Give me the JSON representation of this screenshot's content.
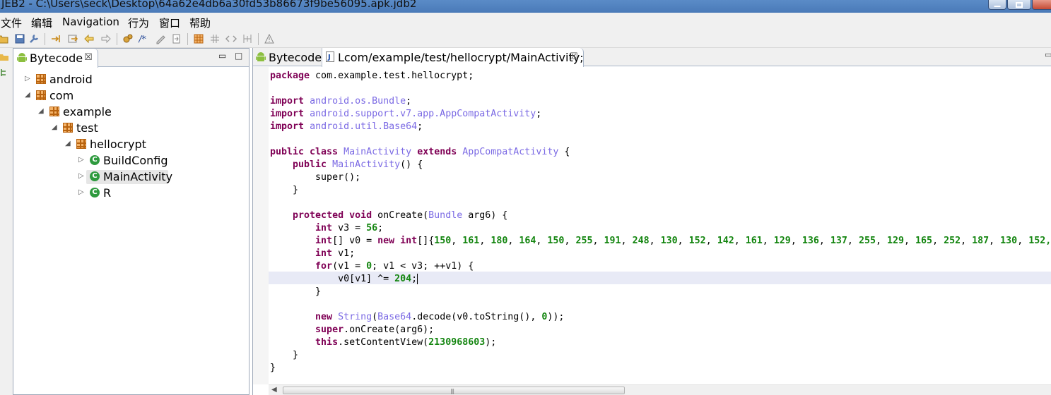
{
  "window": {
    "title": "JEB2 - C:\\Users\\seck\\Desktop\\64a62e4db6a30fd53b86673f9be56095.apk.jdb2"
  },
  "menu": [
    "文件",
    "编辑",
    "Navigation",
    "行为",
    "窗口",
    "帮助"
  ],
  "toolbar": {
    "icons": [
      "open-icon",
      "save-icon",
      "wrench-icon",
      "jump-icon",
      "export-icon",
      "back-icon",
      "forward-icon",
      "decompile-icon",
      "comment-icon",
      "rename-icon",
      "cross-ref-icon",
      "package-icon",
      "structure-icon",
      "code-icon",
      "graph-icon",
      "warning-icon"
    ]
  },
  "left_panel": {
    "tab_label": "Bytecode",
    "tree": [
      {
        "label": "android",
        "type": "package",
        "depth": 0,
        "expanded": false
      },
      {
        "label": "com",
        "type": "package",
        "depth": 0,
        "expanded": true
      },
      {
        "label": "example",
        "type": "package",
        "depth": 1,
        "expanded": true
      },
      {
        "label": "test",
        "type": "package",
        "depth": 2,
        "expanded": true
      },
      {
        "label": "hellocrypt",
        "type": "package",
        "depth": 3,
        "expanded": true
      },
      {
        "label": "BuildConfig",
        "type": "class",
        "depth": 4,
        "expanded": false
      },
      {
        "label": "MainActivity",
        "type": "class",
        "depth": 4,
        "expanded": false,
        "selected": true
      },
      {
        "label": "R",
        "type": "class",
        "depth": 4,
        "expanded": false
      }
    ]
  },
  "editor": {
    "tabs": [
      {
        "label": "Bytecode",
        "active": false
      },
      {
        "label": "Lcom/example/test/hellocrypt/MainActivity;",
        "active": true
      }
    ],
    "code": {
      "l1_kw": "package",
      "l1_rest": " com.example.test.hellocrypt;",
      "imp": "import",
      "imp1": "android.os.Bundle",
      "imp2": "android.support.v7.app.AppCompatActivity",
      "imp3": "android.util.Base64",
      "semi": ";",
      "cls_mod": "public class",
      "cls_name": "MainActivity",
      "cls_ext": "extends",
      "cls_super": "AppCompatActivity",
      "brace_open": " {",
      "ctor_mod": "public",
      "ctor_name": "MainActivity",
      "ctor_rest": "() {",
      "super_call": "super();",
      "close": "}",
      "m_mod": "protected void",
      "m_name": " onCreate(",
      "m_type": "Bundle",
      "m_rest": " arg6) {",
      "int_kw": "int",
      "v3_decl": " v3 = ",
      "v3_val": "56",
      "arr_type": "int",
      "arr_mid": "[] v0 = ",
      "new_kw": "new",
      "arr_open": "[]{",
      "arr_values": [
        "150",
        "161",
        "180",
        "164",
        "150",
        "255",
        "191",
        "248",
        "130",
        "152",
        "142",
        "161",
        "129",
        "136",
        "137",
        "255",
        "129",
        "165",
        "252",
        "187",
        "130",
        "152,"
      ],
      "v1_decl": " v1;",
      "for_kw": "for",
      "for_a": "(v1 = ",
      "for_zero": "0",
      "for_b": "; v1 < v3; ++v1) {",
      "xor_a": "v0[v1] ^= ",
      "xor_val": "204",
      "str_type": "String",
      "b64": "Base64",
      "decode_a": ".decode(v0.toString(), ",
      "decode_zero": "0",
      "decode_b": "));",
      "super_kw": "super",
      "super_rest": ".onCreate(arg6);",
      "this_kw": "this",
      "this_rest": ".setContentView(",
      "view_id": "2130968603",
      "this_end": ");",
      "paren_open": "(",
      "sep": ", "
    }
  },
  "colors": {
    "keyword": "#7f0055",
    "type": "#7b6ae4",
    "number": "#13850f",
    "current_line": "#e8eaf6"
  }
}
